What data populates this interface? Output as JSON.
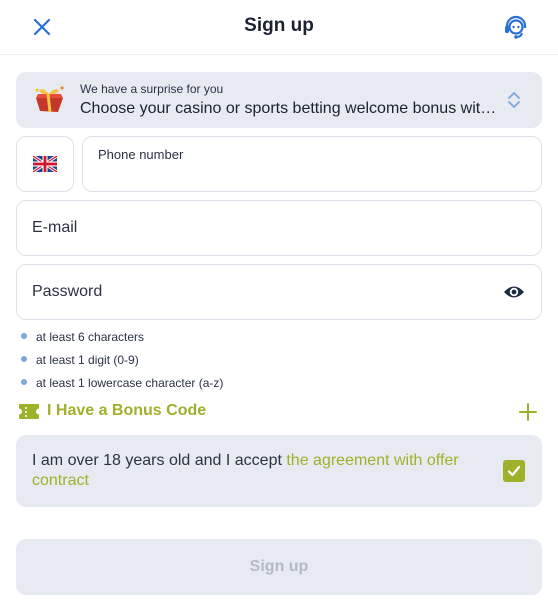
{
  "header": {
    "title": "Sign up",
    "close_icon": "close-icon",
    "support_icon": "headset-support-icon"
  },
  "surprise": {
    "label": "We have a surprise for you",
    "text": "Choose your casino or sports betting welcome bonus with your first deposit",
    "icon": "gift-icon",
    "toggle_icon": "chevron-updown-icon"
  },
  "phone": {
    "country_icon": "uk-flag-icon",
    "label": "Phone number"
  },
  "email": {
    "placeholder": "E-mail"
  },
  "password": {
    "placeholder": "Password",
    "eye_icon": "eye-icon"
  },
  "password_rules": [
    "at least 6 characters",
    "at least 1 digit (0-9)",
    "at least 1 lowercase character (a-z)"
  ],
  "bonus": {
    "label": "I Have a Bonus Code",
    "icon": "ticket-icon",
    "add_icon": "plus-icon"
  },
  "agreement": {
    "text": "I am over 18 years old and I accept ",
    "link": "the agreement with offer contract",
    "checked": true
  },
  "submit": {
    "label": "Sign up"
  },
  "colors": {
    "accent": "#9fb02a",
    "icon_blue": "#2a6fd6",
    "panel_bg": "#e8eaf2",
    "dot_blue": "#7ba7dd",
    "disabled_text": "#b4b9c5"
  }
}
